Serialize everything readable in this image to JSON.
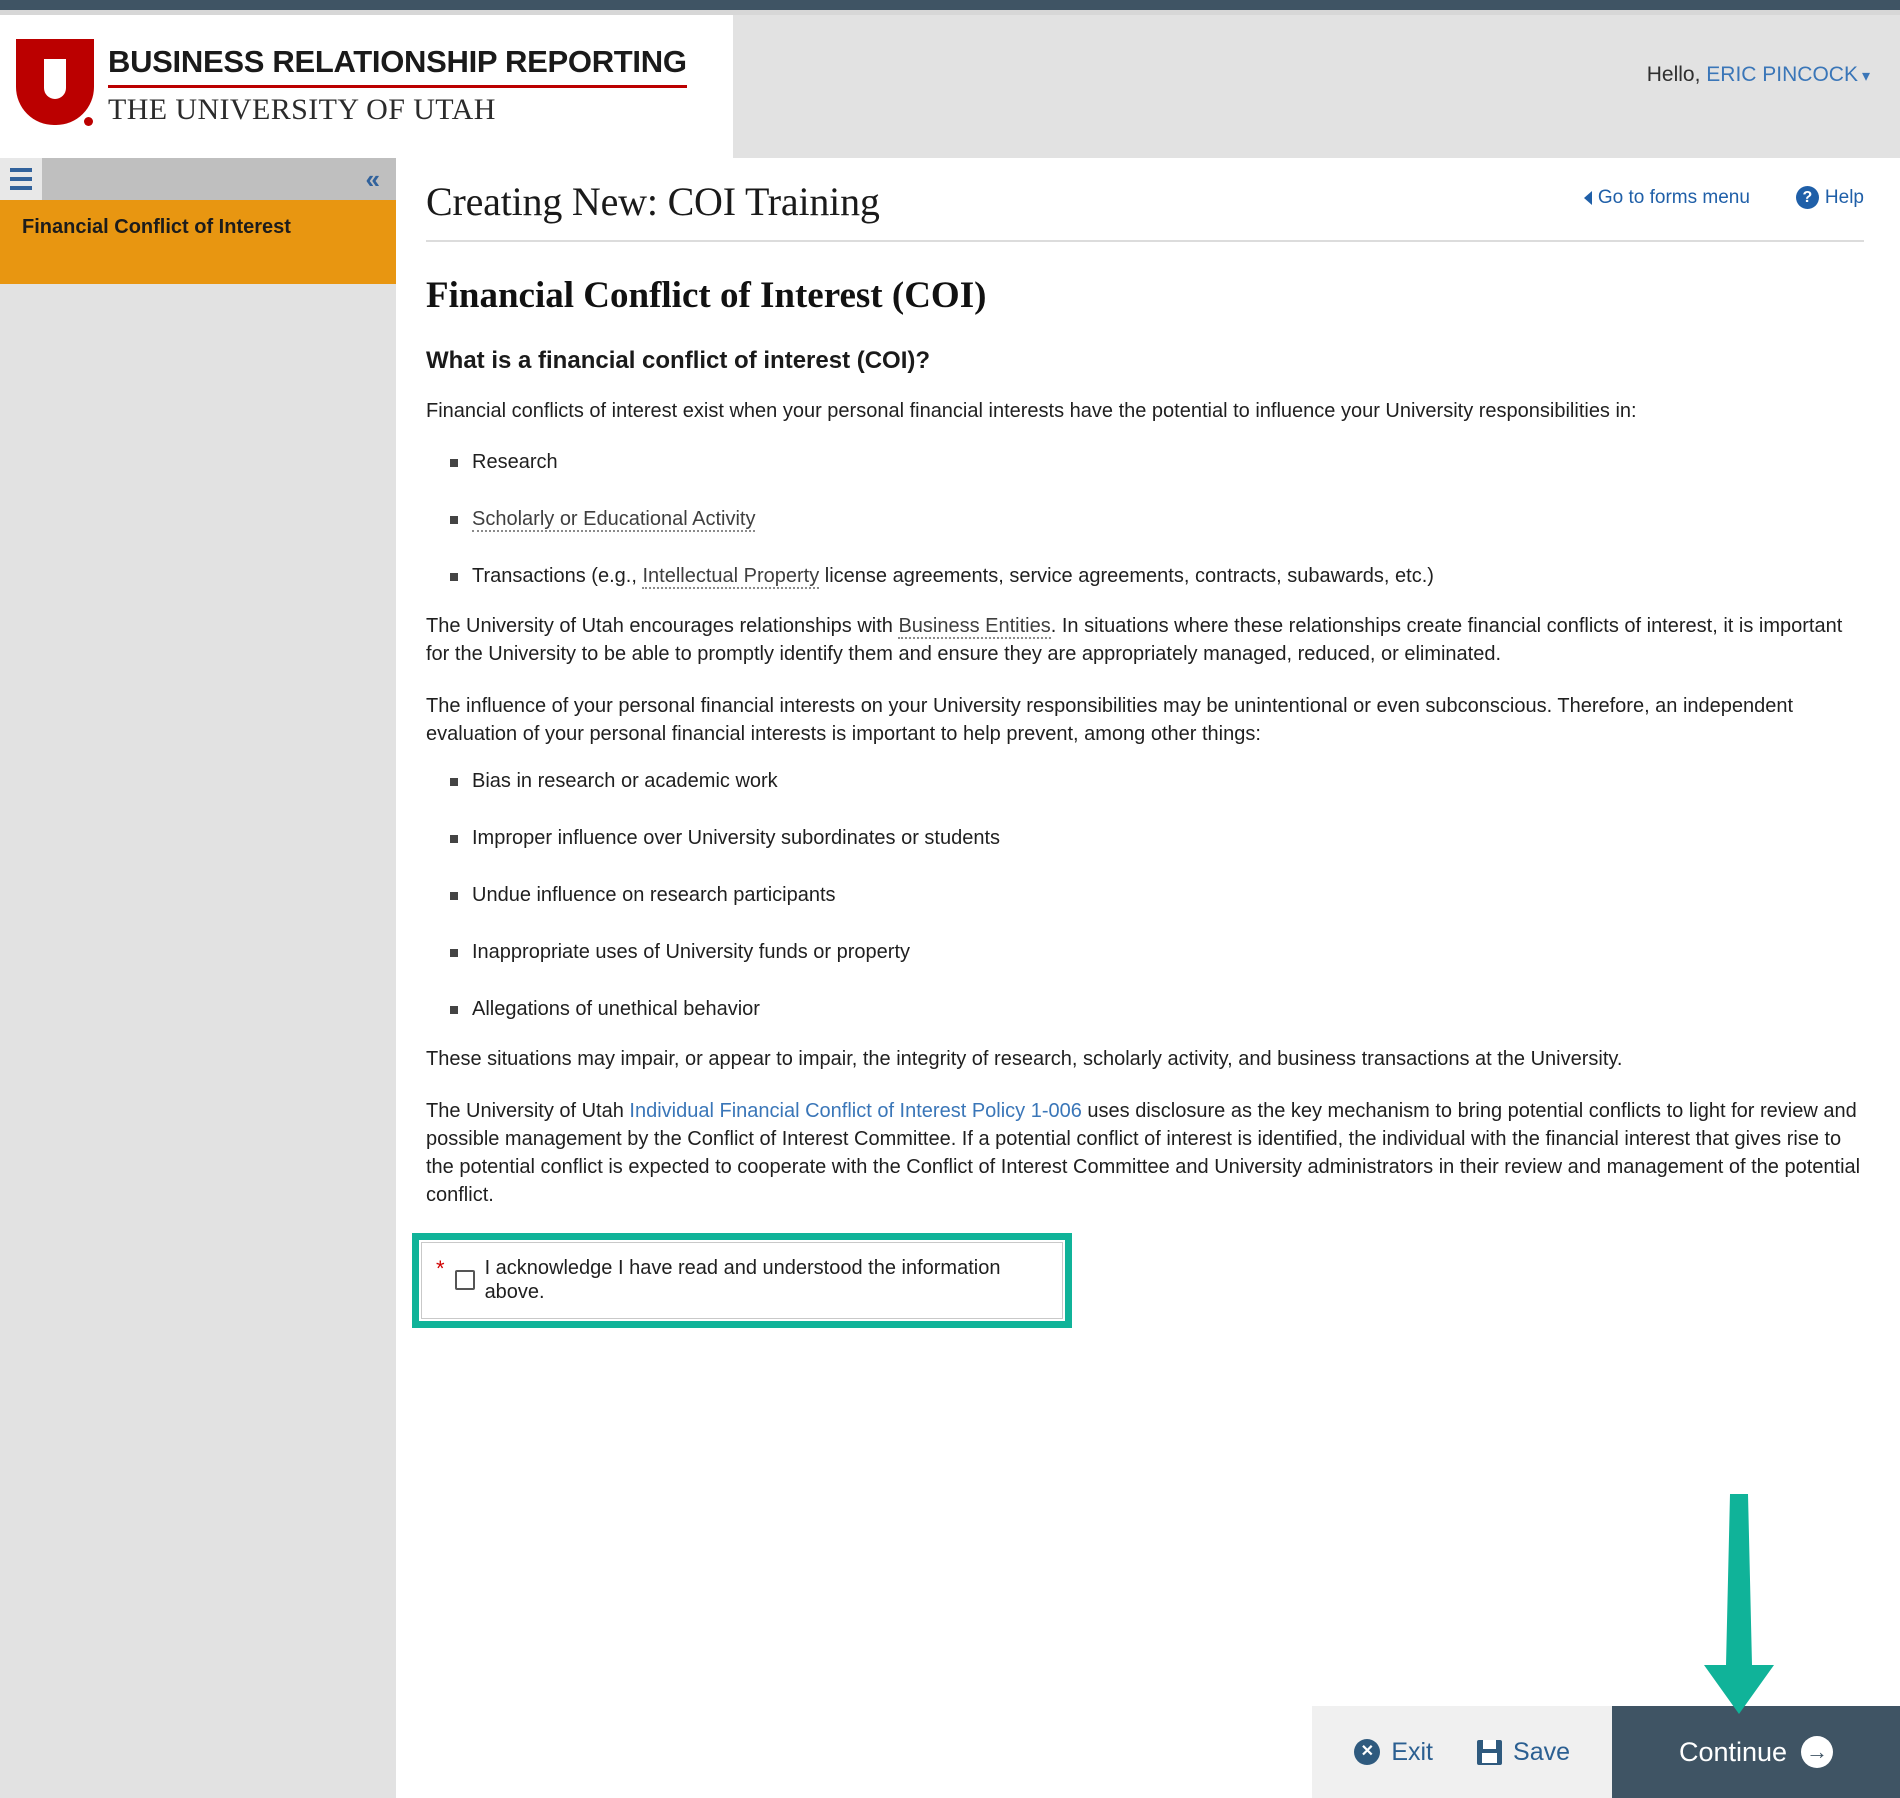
{
  "header": {
    "logo_title": "BUSINESS RELATIONSHIP REPORTING",
    "logo_subtitle": "THE UNIVERSITY OF UTAH",
    "logo_mark": "u-logo-icon",
    "greeting_prefix": "Hello,",
    "user_name": "ERIC PINCOCK",
    "user_caret": "▾",
    "brand_red": "#bb0000",
    "header_bg": "#e2e2e2"
  },
  "sidebar": {
    "menu_icon": "hamburger-menu-icon",
    "collapse_icon": "«",
    "active_color": "#e89611",
    "items": [
      {
        "label": "Financial Conflict of Interest",
        "active": true
      }
    ]
  },
  "content_header": {
    "page_title": "Creating New: COI Training",
    "links": [
      {
        "label": "Go to forms menu",
        "icon": "triangle-left-icon"
      },
      {
        "label": "Help",
        "icon": "question-circle-icon"
      }
    ]
  },
  "main": {
    "section_title": "Financial Conflict of Interest (COI)",
    "question_heading": "What is a financial conflict of interest (COI)?",
    "intro_paragraph": "Financial conflicts of interest exist when your personal financial interests have the potential to influence your University responsibilities in:",
    "list_one": [
      {
        "prefix": "Research",
        "tooltip": "",
        "suffix": ""
      },
      {
        "prefix": "",
        "tooltip": "Scholarly or Educational Activity",
        "suffix": ""
      },
      {
        "prefix": "Transactions (e.g., ",
        "tooltip": "Intellectual Property",
        "suffix": " license agreements, service agreements, contracts, subawards, etc.)"
      }
    ],
    "paragraph_two_a": "The University of Utah encourages relationships with ",
    "paragraph_two_tooltip": "Business Entities",
    "paragraph_two_b": ". In situations where these relationships create financial conflicts of interest, it is important for the University to be able to promptly identify them and ensure they are appropriately managed, reduced, or eliminated.",
    "paragraph_three": "The influence of your personal financial interests on your University responsibilities may be unintentional or even subconscious. Therefore, an independent evaluation of your personal financial interests is important to help prevent, among other things:",
    "list_two": [
      "Bias in research or academic work",
      "Improper influence over University subordinates or students",
      "Undue influence on research participants",
      "Inappropriate uses of University funds or property",
      "Allegations of unethical behavior"
    ],
    "paragraph_four": "These situations may impair, or appear to impair, the integrity of research, scholarly activity, and business transactions at the University.",
    "paragraph_five_a": "The University of Utah ",
    "paragraph_five_link": "Individual Financial Conflict of Interest Policy 1-006",
    "paragraph_five_b": " uses disclosure as the key mechanism to bring potential conflicts to light for review and possible management by the Conflict of Interest Committee. If a potential conflict of interest is identified, the individual with the financial interest that gives rise to the potential conflict is expected to cooperate with the Conflict of Interest Committee and University administrators in their review and management of the potential conflict."
  },
  "acknowledgment": {
    "required_marker": "*",
    "label": "I acknowledge I have read and understood the information above.",
    "checked": false,
    "highlight_color": "#10b399"
  },
  "actions": {
    "exit_label": "Exit",
    "exit_icon": "close-circle-icon",
    "save_label": "Save",
    "save_icon": "floppy-disk-icon",
    "continue_label": "Continue",
    "continue_icon": "arrow-right-circle-icon",
    "continue_bg": "#3f5464"
  },
  "annotation": {
    "arrow_color": "#10b399",
    "arrow_direction": "down",
    "points_to": "continue-button"
  }
}
